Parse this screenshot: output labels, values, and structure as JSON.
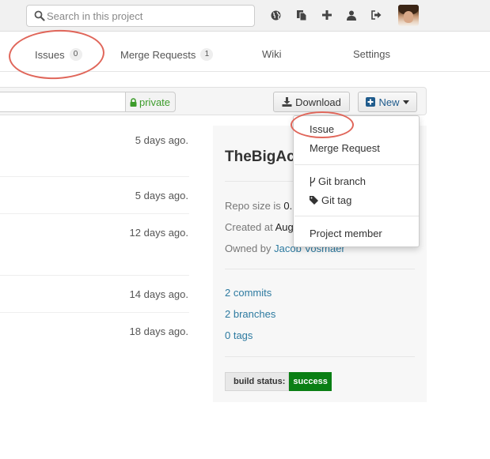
{
  "header": {
    "search_placeholder": "Search in this project",
    "icons": [
      "globe-icon",
      "copy-icon",
      "plus-icon",
      "user-icon",
      "sign-out-icon"
    ],
    "avatar": "user-avatar"
  },
  "nav": {
    "tabs": [
      {
        "label": "Issues",
        "badge": "0"
      },
      {
        "label": "Merge Requests",
        "badge": "1"
      },
      {
        "label": "Wiki"
      },
      {
        "label": "Settings"
      }
    ]
  },
  "toolbar": {
    "clone_url_value": "",
    "visibility_label": "private",
    "download_label": "Download",
    "new_label": "New"
  },
  "new_menu": {
    "items": [
      {
        "label": "Issue"
      },
      {
        "label": "Merge Request"
      },
      {
        "label": "Git branch",
        "icon": "code-fork-icon"
      },
      {
        "label": "Git tag",
        "icon": "tag-icon"
      },
      {
        "label": "Project member"
      }
    ]
  },
  "events": [
    {
      "time": "5 days ago."
    },
    {
      "time": "5 days ago."
    },
    {
      "time": "12 days ago."
    },
    {
      "time": "14 days ago."
    },
    {
      "time": "18 days ago."
    }
  ],
  "project": {
    "title": "TheBigAc",
    "repo_size_label": "Repo size is ",
    "repo_size_value": "0.",
    "created_label": "Created at ",
    "created_value": "Aug",
    "owned_label": "Owned by ",
    "owner": "Jacob Vosmaer",
    "commits": "2 commits",
    "branches": "2 branches",
    "tags": "0 tags",
    "build_status_label": "build status:",
    "build_status_value": "success"
  },
  "colors": {
    "annotation_ring": "#e0665a",
    "success": "#0a7f14",
    "link": "#2d7aa0",
    "private": "#3c9c2a",
    "new_icon": "#1f5b8c"
  }
}
